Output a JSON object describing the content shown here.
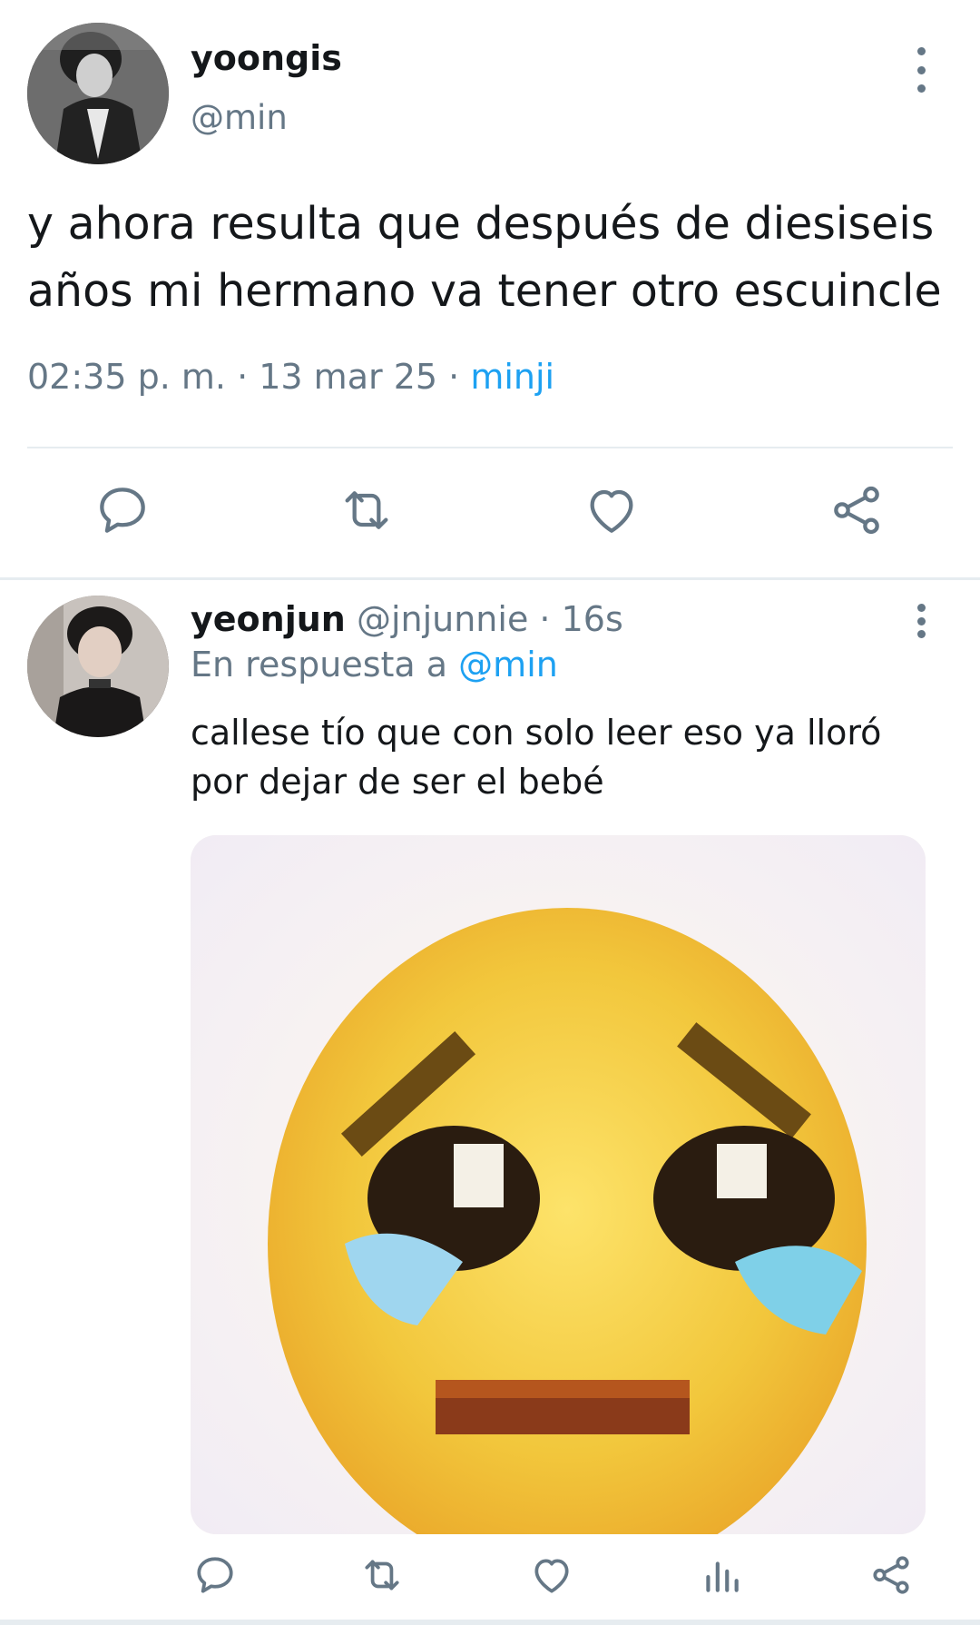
{
  "main_tweet": {
    "author_name": "yoongis",
    "author_handle": "@min",
    "text": "y ahora resulta que después de diesiseis años mi hermano va tener otro escuincle",
    "time": "02:35 p. m.",
    "separator": "·",
    "date": "13 mar 25",
    "source": "minji",
    "actions": [
      "reply-icon",
      "retweet-icon",
      "like-icon",
      "share-icon"
    ]
  },
  "reply_tweet": {
    "author_name": "yeonjun",
    "author_handle": "@jnjunnie",
    "separator": "·",
    "time": "16s",
    "reply_prefix": "En respuesta a",
    "reply_mention": "@min",
    "text": "callese tío que con solo leer eso ya lloró por dejar de ser el bebé",
    "media_icon": "pleading-crying-emoji",
    "actions": [
      "reply-icon",
      "retweet-icon",
      "like-icon",
      "analytics-icon",
      "share-icon"
    ]
  },
  "colors": {
    "text": "#14171a",
    "secondary": "#657786",
    "link": "#1da1f2",
    "divider": "#e6ecf0"
  }
}
